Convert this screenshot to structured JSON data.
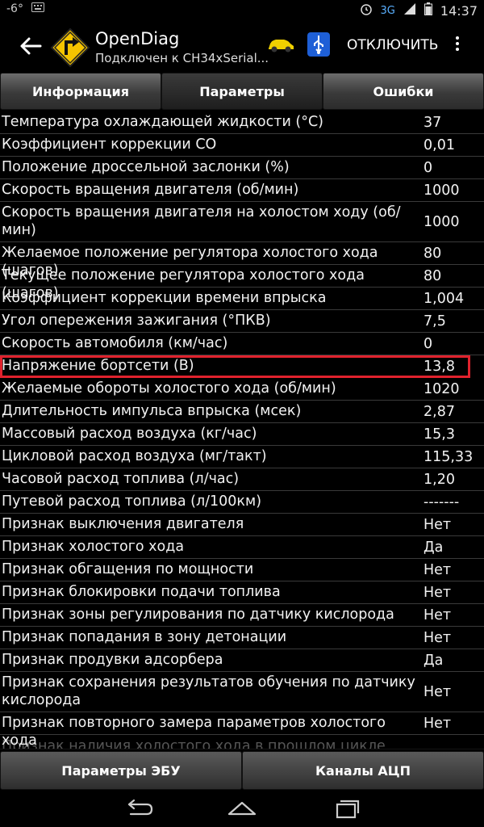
{
  "status_bar": {
    "temperature": "-6°",
    "network": "3G",
    "time": "14:37"
  },
  "header": {
    "title": "OpenDiag",
    "subtitle": "Подключен к CH34xSerial...",
    "disconnect_label": "ОТКЛЮЧИТЬ"
  },
  "tabs": [
    {
      "label": "Информация"
    },
    {
      "label": "Параметры"
    },
    {
      "label": "Ошибки"
    }
  ],
  "parameters": [
    {
      "name": "Температура охлаждающей жидкости (°C)",
      "value": "37"
    },
    {
      "name": "Коэффициент коррекции CO",
      "value": "0,01"
    },
    {
      "name": "Положение дроссельной заслонки (%)",
      "value": "0"
    },
    {
      "name": "Скорость вращения двигателя (об/мин)",
      "value": "1000"
    },
    {
      "name": "Скорость вращения двигателя на холостом ходу (об/мин)",
      "value": "1000"
    },
    {
      "name": "Желаемое положение регулятора холостого хода (шагов)",
      "value": "80"
    },
    {
      "name": "Текущее положение регулятора холостого хода (шагов)",
      "value": "80"
    },
    {
      "name": "Коэффициент коррекции времени впрыска",
      "value": "1,004"
    },
    {
      "name": "Угол опережения зажигания (°ПКВ)",
      "value": "7,5"
    },
    {
      "name": "Скорость автомобиля (км/час)",
      "value": "0"
    },
    {
      "name": "Напряжение бортсети (В)",
      "value": "13,8"
    },
    {
      "name": "Желаемые обороты холостого хода (об/мин)",
      "value": "1020"
    },
    {
      "name": "Длительность импульса впрыска (мсек)",
      "value": "2,87"
    },
    {
      "name": "Массовый расход воздуха (кг/час)",
      "value": "15,3"
    },
    {
      "name": "Цикловой расход воздуха (мг/такт)",
      "value": "115,33"
    },
    {
      "name": "Часовой расход топлива (л/час)",
      "value": "1,20"
    },
    {
      "name": "Путевой расход топлива (л/100км)",
      "value": "-------"
    },
    {
      "name": "Признак выключения двигателя",
      "value": "Нет"
    },
    {
      "name": "Признак холостого хода",
      "value": "Да"
    },
    {
      "name": "Признак обгащения по мощности",
      "value": "Нет"
    },
    {
      "name": "Признак блокировки подачи топлива",
      "value": "Нет"
    },
    {
      "name": "Признак зоны регулирования по датчику кислорода",
      "value": "Нет"
    },
    {
      "name": "Признак попадания в зону детонации",
      "value": "Нет"
    },
    {
      "name": "Признак продувки адсорбера",
      "value": "Да"
    },
    {
      "name": "Признак сохранения результатов обучения по датчику кислорода",
      "value": "Нет"
    },
    {
      "name": "Признак повторного замера параметров холостого хода",
      "value": "Нет"
    },
    {
      "name": "Признак наличия холостого хода в прошлом цикле",
      "value": ""
    }
  ],
  "bottom_buttons": [
    {
      "label": "Параметры ЭБУ"
    },
    {
      "label": "Каналы АЦП"
    }
  ],
  "highlight_color": "#e0222d"
}
